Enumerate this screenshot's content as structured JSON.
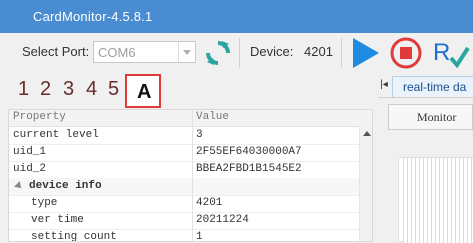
{
  "window": {
    "title": "CardMonitor-4.5.8.1"
  },
  "toolbar": {
    "select_port_label": "Select Port:",
    "port_value": "COM6",
    "device_label": "Device:",
    "device_value": "4201"
  },
  "tabs": {
    "items": [
      "1",
      "2",
      "3",
      "4",
      "5",
      "A"
    ],
    "active": "A"
  },
  "grid": {
    "columns": [
      "Property",
      "Value"
    ],
    "rows": [
      {
        "key": "current level",
        "value": "3"
      },
      {
        "key": "uid_1",
        "value": "2F55EF64030000A7"
      },
      {
        "key": "uid_2",
        "value": "BBEA2FBD1B1545E2"
      }
    ],
    "category": {
      "name": "device info",
      "rows": [
        {
          "key": "type",
          "value": "4201"
        },
        {
          "key": "ver time",
          "value": "20211224"
        },
        {
          "key": "setting count",
          "value": "1"
        }
      ]
    }
  },
  "right_panel": {
    "tab_label": "real-time da",
    "monitor_button": "Monitor"
  },
  "colors": {
    "titlebar": "#4a8cd2",
    "play_icon": "#1f8be0",
    "stop_icon": "#e03a3a",
    "refresh_icon": "#2aa5a0",
    "active_tab_highlight": "#e03a3a"
  }
}
